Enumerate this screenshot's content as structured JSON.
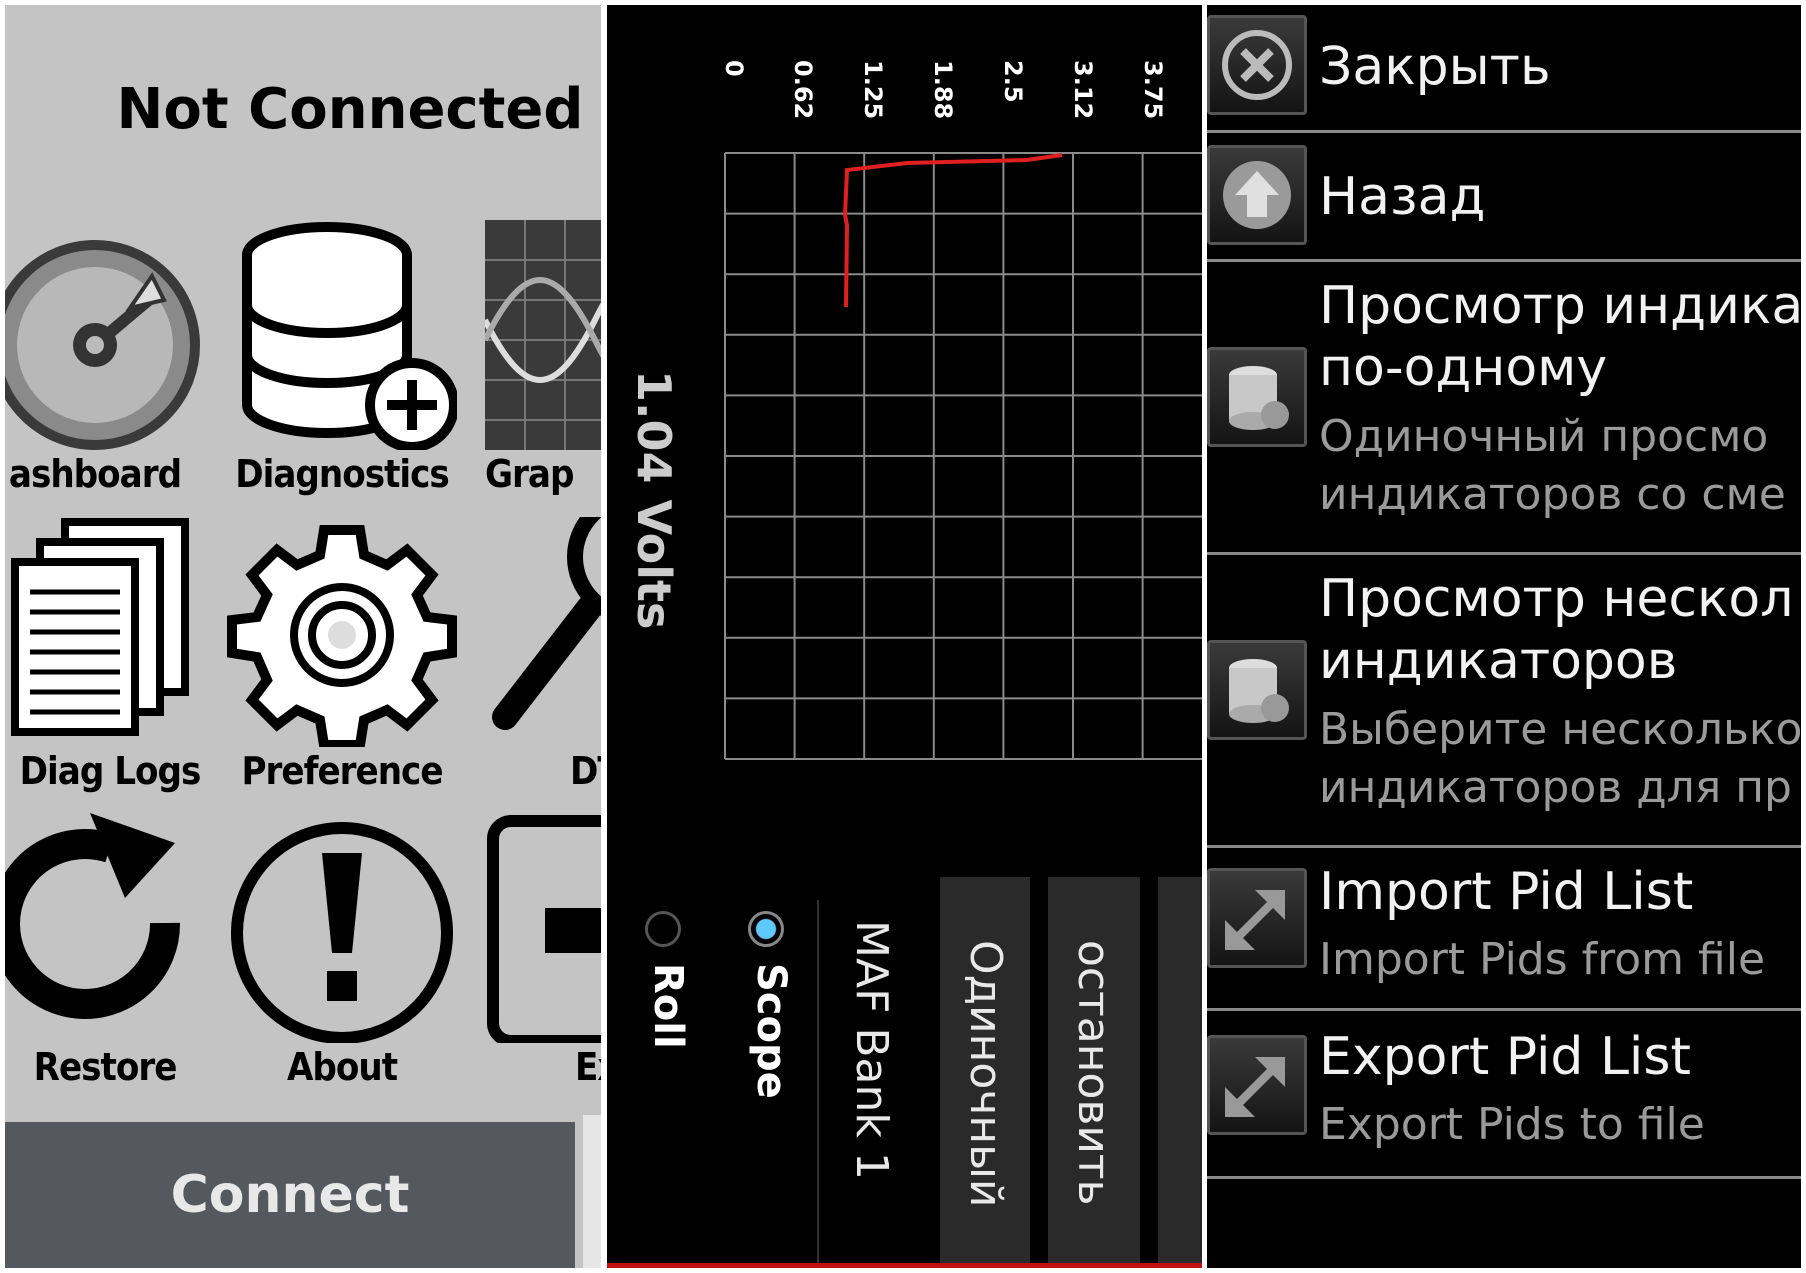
{
  "main_menu": {
    "status": "Not Connected",
    "tiles": [
      {
        "label": "ashboard",
        "icon": "speedometer-icon"
      },
      {
        "label": "Diagnostics",
        "icon": "database-add-icon"
      },
      {
        "label": "Grap",
        "icon": "graph-icon"
      },
      {
        "label": "Diag Logs",
        "icon": "documents-icon"
      },
      {
        "label": "Preference",
        "icon": "gear-icon"
      },
      {
        "label": "DT",
        "icon": "magnifier-icon"
      },
      {
        "label": "Restore",
        "icon": "refresh-icon"
      },
      {
        "label": "About",
        "icon": "exclamation-icon"
      },
      {
        "label": "Ex",
        "icon": "exit-icon"
      }
    ],
    "connect_label": "Connect"
  },
  "graph": {
    "ticks": [
      "0",
      "0.62",
      "1.25",
      "1.88",
      "2.5",
      "3.12",
      "3.75"
    ],
    "reading": "1.04 Volts",
    "series_name": "MAF Bank 1",
    "modes": [
      "Scope",
      "Roll"
    ],
    "selected_mode": "Scope",
    "buttons": [
      "Одиночный",
      "остановить"
    ],
    "line_color": "#e02020"
  },
  "menu": {
    "items": [
      {
        "title": "Закрыть",
        "icon": "close-icon"
      },
      {
        "title": "Назад",
        "icon": "back-up-icon"
      },
      {
        "title_lines": [
          "Просмотр индика",
          "по-одному"
        ],
        "subtitle_lines": [
          "Одиночный просмо",
          "индикаторов со сме"
        ],
        "icon": "database-icon"
      },
      {
        "title_lines": [
          "Просмотр нескол",
          "индикаторов"
        ],
        "subtitle_lines": [
          "Выберите несколько",
          "индикаторов для пр"
        ],
        "icon": "database-icon"
      },
      {
        "title": "Import Pid List",
        "subtitle": "Import Pids from file",
        "icon": "import-icon"
      },
      {
        "title": "Export Pid List",
        "subtitle": "Export Pids to file",
        "icon": "export-icon"
      }
    ]
  }
}
